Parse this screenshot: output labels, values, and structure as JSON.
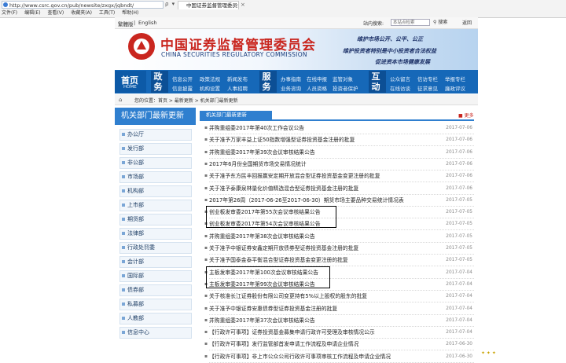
{
  "browser": {
    "address": "http://www.csrc.gov.cn/pub/newsite/zxgx/jgbndt/",
    "address_tools": "ρ ▾ ○",
    "tab_title": "中国证券监督管理委员会",
    "tab_close": "×",
    "menu": [
      "文件(F)",
      "编辑(E)",
      "查看(V)",
      "收藏夹(A)",
      "工具(T)",
      "帮助(H)"
    ]
  },
  "topbar": {
    "lang_cn": "繁體版",
    "sep": "|",
    "lang_en": "English",
    "search_label": "站内搜索:",
    "search_placeholder": "本站点检索",
    "search_button": "搜索",
    "back": "返回"
  },
  "header": {
    "title_cn": "中国证券监督管理委员会",
    "title_en": "CHINA SECURITIES REGULATORY COMMISSION",
    "slogans": [
      "维护市场公开、公平、公正",
      "维护投资者特别是中小投资者合法权益",
      "促进资本市场健康发展"
    ]
  },
  "nav": {
    "home_cn": "首页",
    "home_en": "HOME",
    "groups": [
      {
        "label": "政务",
        "items": [
          "信息公开",
          "政策法规",
          "新闻发布",
          "信息披露",
          "机构设置",
          "人事招聘"
        ]
      },
      {
        "label": "服务",
        "items": [
          "办事指南",
          "在线申报",
          "监管对象",
          "业务咨询",
          "人员资格",
          "投资者保护"
        ]
      },
      {
        "label": "互动",
        "items": [
          "公众留言",
          "信访专栏",
          "举报专栏",
          "在线访谈",
          "征求意见",
          "廉政评议"
        ]
      }
    ]
  },
  "breadcrumb": {
    "icon": "⌂",
    "text": "您的位置：首页 > 最新更新 > 机关部门最新更新"
  },
  "sidebar": {
    "title": "机关部门最新更新",
    "items": [
      "办公厅",
      "发行部",
      "非公部",
      "市场部",
      "机构部",
      "上市部",
      "期货部",
      "法律部",
      "行政处罚委",
      "会计部",
      "国际部",
      "债券部",
      "私募部",
      "人教部",
      "信息中心"
    ]
  },
  "content": {
    "column_title": "机关部门最新更新",
    "more": "更多",
    "rows": [
      {
        "title": "并购重组委2017年第40次工作会议公告",
        "date": "2017-07-06"
      },
      {
        "title": "关于准予万家丰益上证50指数增强型证券投资基金注册的批复",
        "date": "2017-07-06"
      },
      {
        "title": "并购重组委2017年第39次会议审核结果公告",
        "date": "2017-07-06"
      },
      {
        "title": "2017年6月份全国期货市场交易情况统计",
        "date": "2017-07-06"
      },
      {
        "title": "关于准予东方民丰回报赢安定期开放混合型证券投资基金变更注册的批复",
        "date": "2017-07-06"
      },
      {
        "title": "关于准予泰康泉林量化价值精选混合型证券投资基金注册的批复",
        "date": "2017-07-06"
      },
      {
        "title": "2017年第26周（2017-06-26至2017-06-30）期货市场主要品种交易统计情况表",
        "date": "2017-07-05"
      },
      {
        "title": "创业板发审委2017年第55次会议审核结果公告",
        "date": "2017-07-05"
      },
      {
        "title": "创业板发审委2017年第54次会议审核结果公告",
        "date": "2017-07-05"
      },
      {
        "title": "并购重组委2017年第38次会议审核结果公告",
        "date": "2017-07-05"
      },
      {
        "title": "关于准予中银证券安鑫定期开放债券型证券投资基金注册的批复",
        "date": "2017-07-05"
      },
      {
        "title": "关于准予国泰金泰平衡混合型证券投资基金变更注册的批复",
        "date": "2017-07-05"
      },
      {
        "title": "主板发审委2017年第100次会议审核结果公告",
        "date": "2017-07-04"
      },
      {
        "title": "主板发审委2017年第99次会议审核结果公告",
        "date": "2017-07-04"
      },
      {
        "title": "关于核准长江证券股份有限公司变更持有5%以上股权的股东的批复",
        "date": "2017-07-04"
      },
      {
        "title": "关于准予中银证券安惠债券型证券投资基金注册的批复",
        "date": "2017-07-04"
      },
      {
        "title": "并购重组委2017年第37次会议审核结果公告",
        "date": "2017-07-04"
      },
      {
        "title": "【行政许可事项】证券投资基金募集申请行政许可受理及审核情况公示",
        "date": "2017-07-04"
      },
      {
        "title": "【行政许可事项】发行监管部首发申请工作流程及申请企业情况",
        "date": "2017-06-30"
      },
      {
        "title": "【行政许可事项】非上市公众公司行政许可事项审核工作流程及申请企业情况",
        "date": "2017-06-30"
      }
    ]
  },
  "tray": "✦ ✦ ✦"
}
